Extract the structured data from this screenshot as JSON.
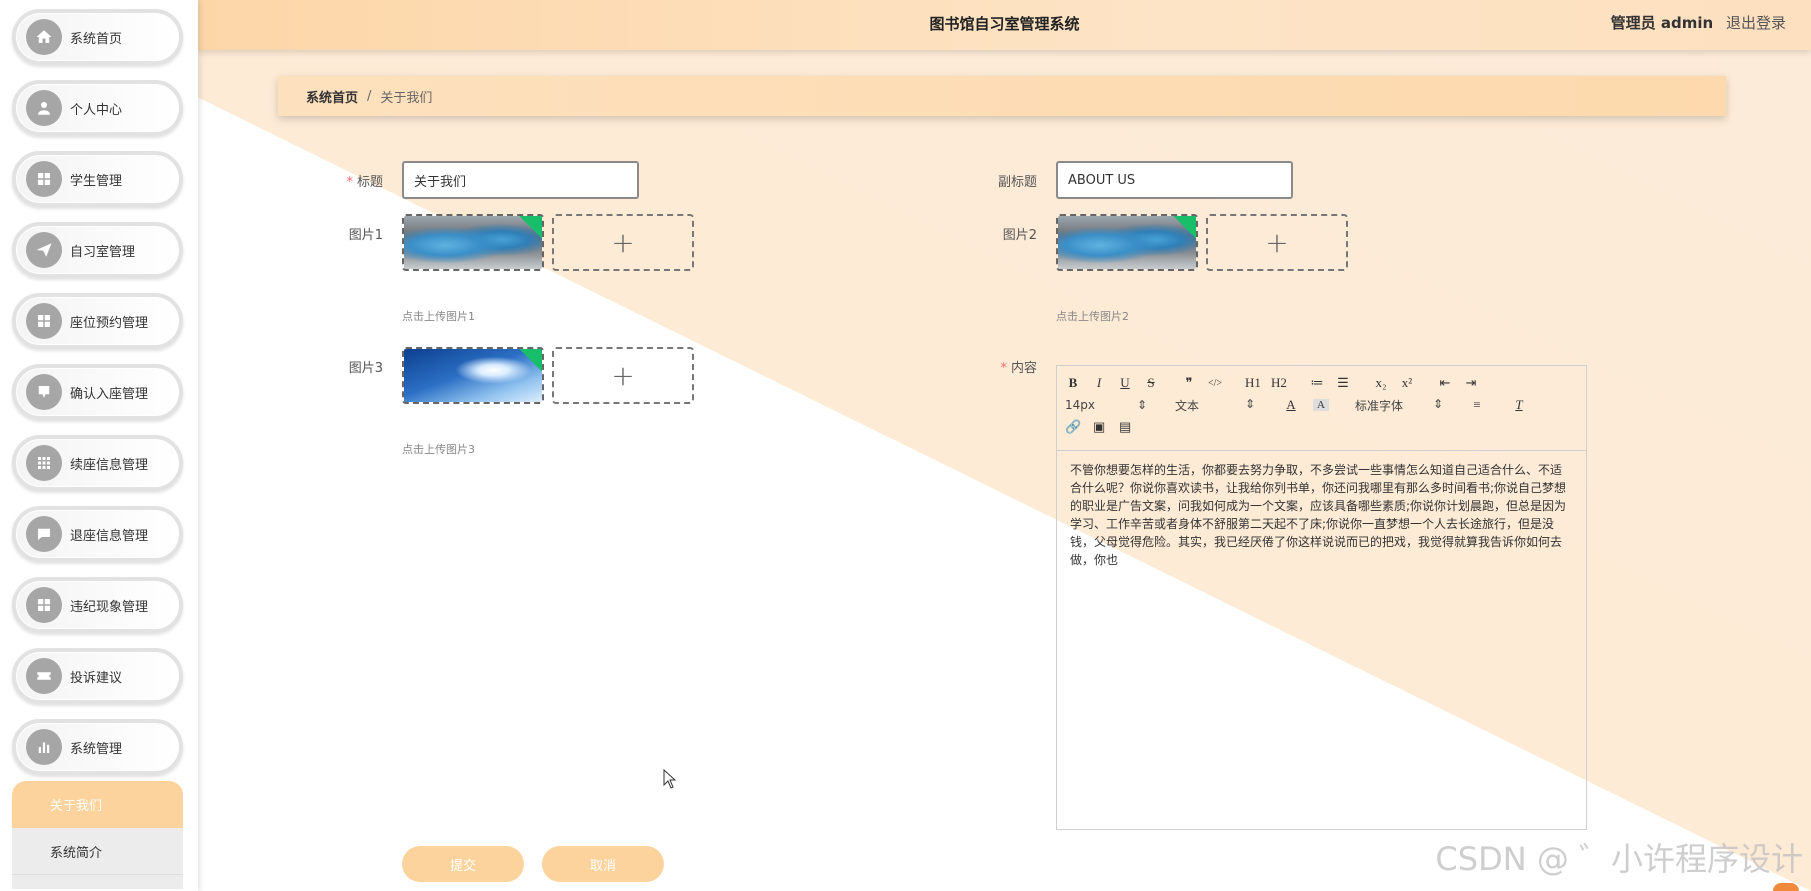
{
  "header": {
    "title": "图书馆自习室管理系统",
    "user": "管理员 admin",
    "logout": "退出登录"
  },
  "sidebar": {
    "items": [
      {
        "label": "系统首页",
        "icon": "home-icon"
      },
      {
        "label": "个人中心",
        "icon": "user-icon"
      },
      {
        "label": "学生管理",
        "icon": "grid-icon"
      },
      {
        "label": "自习室管理",
        "icon": "send-icon"
      },
      {
        "label": "座位预约管理",
        "icon": "grid-icon"
      },
      {
        "label": "确认入座管理",
        "icon": "message-icon"
      },
      {
        "label": "续座信息管理",
        "icon": "apps-icon"
      },
      {
        "label": "退座信息管理",
        "icon": "chat-icon"
      },
      {
        "label": "违纪现象管理",
        "icon": "grid-icon"
      },
      {
        "label": "投诉建议",
        "icon": "ticket-icon"
      },
      {
        "label": "系统管理",
        "icon": "chart-icon"
      }
    ],
    "submenu": [
      {
        "label": "关于我们",
        "active": true
      },
      {
        "label": "系统简介",
        "active": false
      }
    ]
  },
  "breadcrumb": {
    "home": "系统首页",
    "separator": "/",
    "current": "关于我们"
  },
  "form": {
    "title_label": "标题",
    "title_value": "关于我们",
    "subtitle_label": "副标题",
    "subtitle_value": "ABOUT US",
    "pic1_label": "图片1",
    "pic1_tip": "点击上传图片1",
    "pic2_label": "图片2",
    "pic2_tip": "点击上传图片2",
    "pic3_label": "图片3",
    "pic3_tip": "点击上传图片3",
    "content_label": "内容",
    "upload_plus": "+",
    "required_mark": "*"
  },
  "editor": {
    "toolbar_row1": [
      "B",
      "I",
      "U",
      "S",
      "❞",
      "</>",
      "H1",
      "H2",
      "≔",
      "☰",
      "x₂",
      "x²",
      "⇤",
      "⇥"
    ],
    "font_size": "14px",
    "format": "文本",
    "font_family": "标准字体",
    "text": "不管你想要怎样的生活，你都要去努力争取，不多尝试一些事情怎么知道自己适合什么、不适合什么呢？你说你喜欢读书，让我给你列书单，你还问我哪里有那么多时间看书;你说自己梦想的职业是广告文案，问我如何成为一个文案，应该具备哪些素质;你说你计划晨跑，但总是因为学习、工作辛苦或者身体不舒服第二天起不了床;你说你一直梦想一个人去长途旅行，但是没钱，父母觉得危险。其实，我已经厌倦了你这样说说而已的把戏，我觉得就算我告诉你如何去做，你也"
  },
  "buttons": {
    "submit": "提交",
    "cancel": "取消"
  },
  "watermark": "CSDN @ ゛小许程序设计",
  "colors": {
    "accent": "#fdd39d",
    "header_bg": "#fde0bf",
    "required": "#f56c6c",
    "badge_green": "#19be6b"
  }
}
